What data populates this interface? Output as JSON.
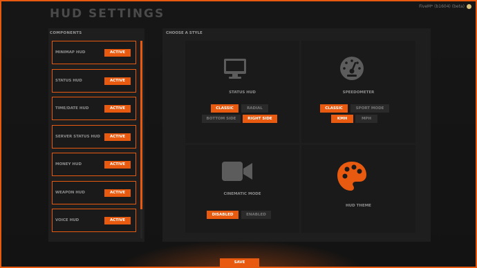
{
  "header": {
    "title": "HUD SETTINGS",
    "build_info": "FiveM* (b1604) (beta)"
  },
  "components": {
    "title": "COMPONENTS",
    "items": [
      {
        "label": "MINIMAP HUD",
        "status": "ACTIVE"
      },
      {
        "label": "STATUS HUD",
        "status": "ACTIVE"
      },
      {
        "label": "TIME/DATE HUD",
        "status": "ACTIVE"
      },
      {
        "label": "SERVER STATUS HUD",
        "status": "ACTIVE"
      },
      {
        "label": "MONEY HUD",
        "status": "ACTIVE"
      },
      {
        "label": "WEAPON HUD",
        "status": "ACTIVE"
      },
      {
        "label": "VOICE HUD",
        "status": "ACTIVE"
      }
    ]
  },
  "styles": {
    "title": "CHOOSE A STYLE",
    "status_hud": {
      "icon": "monitor-icon",
      "label": "STATUS HUD",
      "options": [
        "CLASSIC",
        "RADIAL",
        "BOTTOM SIDE",
        "RIGHT SIDE"
      ],
      "selected": [
        "CLASSIC",
        "RIGHT SIDE"
      ]
    },
    "speedometer": {
      "icon": "speedometer-icon",
      "label": "SPEEDOMETER",
      "options": [
        "CLASSIC",
        "SPORT MODE",
        "KMH",
        "MPH"
      ],
      "selected": [
        "CLASSIC",
        "KMH"
      ]
    },
    "cinematic": {
      "icon": "video-camera-icon",
      "label": "CINEMATIC MODE",
      "options": [
        "DISABLED",
        "ENABLED"
      ],
      "selected": [
        "DISABLED"
      ]
    },
    "theme": {
      "icon": "palette-icon",
      "label": "HUD THEME"
    }
  },
  "footer": {
    "save_label": "SAVE"
  },
  "colors": {
    "accent": "#e85a0f",
    "panel": "#1e1e1e",
    "background": "#141414"
  }
}
